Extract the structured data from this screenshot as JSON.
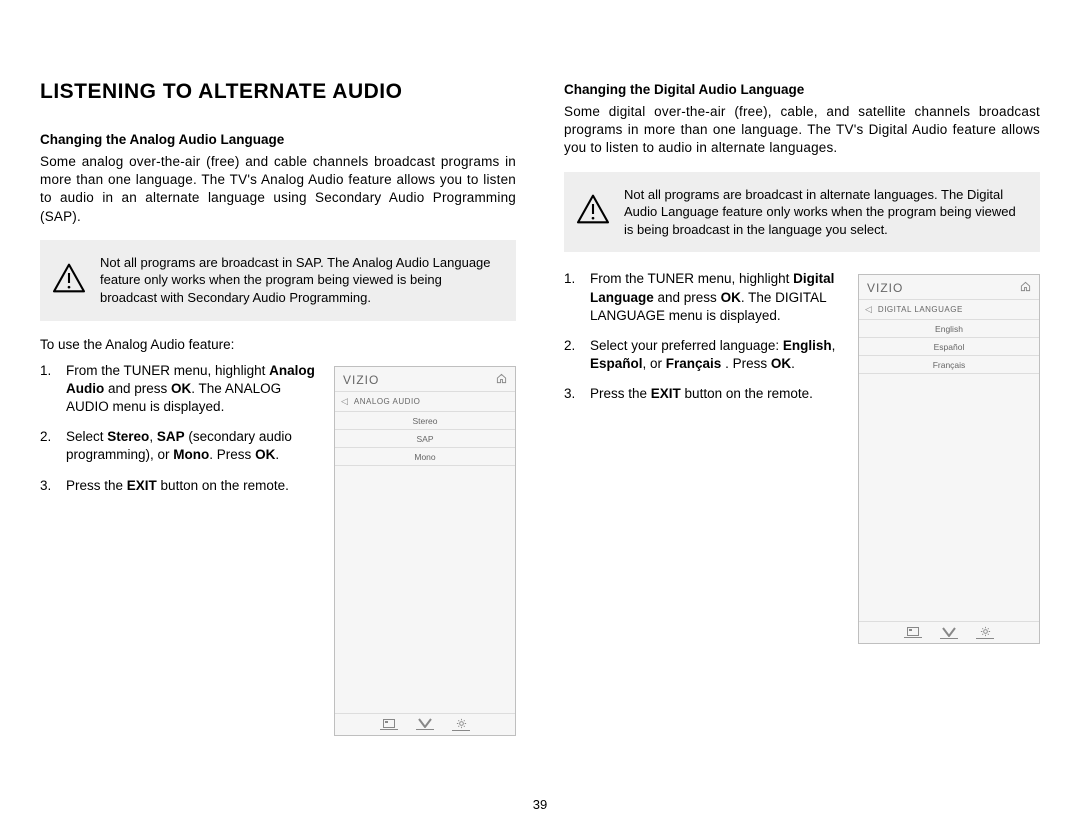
{
  "page_number": "39",
  "section_title": "LISTENING TO ALTERNATE AUDIO",
  "left": {
    "subhead": "Changing the Analog Audio Language",
    "intro": "Some analog over-the-air (free) and cable channels broadcast programs in more than one language. The TV's Analog Audio feature allows you to listen to audio in an alternate language using Secondary Audio Programming (SAP).",
    "note": "Not all programs are broadcast in SAP. The Analog Audio Language feature only works when the program being viewed is being broadcast with Secondary Audio Programming.",
    "lead": "To use the Analog Audio feature:",
    "steps": {
      "s1_a": "From the TUNER menu, highlight ",
      "s1_b": "Analog Audio",
      "s1_c": " and press ",
      "s1_d": "OK",
      "s1_e": ". The ANALOG AUDIO menu is displayed.",
      "s2_a": "Select ",
      "s2_b": "Stereo",
      "s2_c": ", ",
      "s2_d": "SAP",
      "s2_e": " (secondary audio programming), or ",
      "s2_f": "Mono",
      "s2_g": ". Press ",
      "s2_h": "OK",
      "s2_i": ".",
      "s3_a": "Press the ",
      "s3_b": "EXIT",
      "s3_c": " button on the remote."
    },
    "tv": {
      "brand": "VIZIO",
      "title": "ANALOG AUDIO",
      "items": [
        "Stereo",
        "SAP",
        "Mono"
      ]
    }
  },
  "right": {
    "subhead": "Changing the Digital Audio Language",
    "intro": "Some digital over-the-air (free), cable, and satellite channels broadcast programs in more than one language. The TV's Digital Audio feature allows you to listen to audio in alternate languages.",
    "note": "Not all programs are broadcast in alternate languages. The Digital Audio Language feature only works when the program being viewed is being broadcast in the language you select.",
    "steps": {
      "s1_a": "From the TUNER menu, highlight ",
      "s1_b": "Digital Language",
      "s1_c": " and press ",
      "s1_d": "OK",
      "s1_e": ". The DIGITAL LANGUAGE menu is displayed.",
      "s2_a": "Select your preferred language: ",
      "s2_b": "English",
      "s2_c": ", ",
      "s2_d": "Español",
      "s2_e": ",  or ",
      "s2_f": "Français",
      "s2_g": " . Press ",
      "s2_h": "OK",
      "s2_i": ".",
      "s3_a": "Press the ",
      "s3_b": "EXIT",
      "s3_c": " button on the remote."
    },
    "tv": {
      "brand": "VIZIO",
      "title": "DIGITAL LANGUAGE",
      "items": [
        "English",
        "Español",
        "Français"
      ]
    }
  }
}
